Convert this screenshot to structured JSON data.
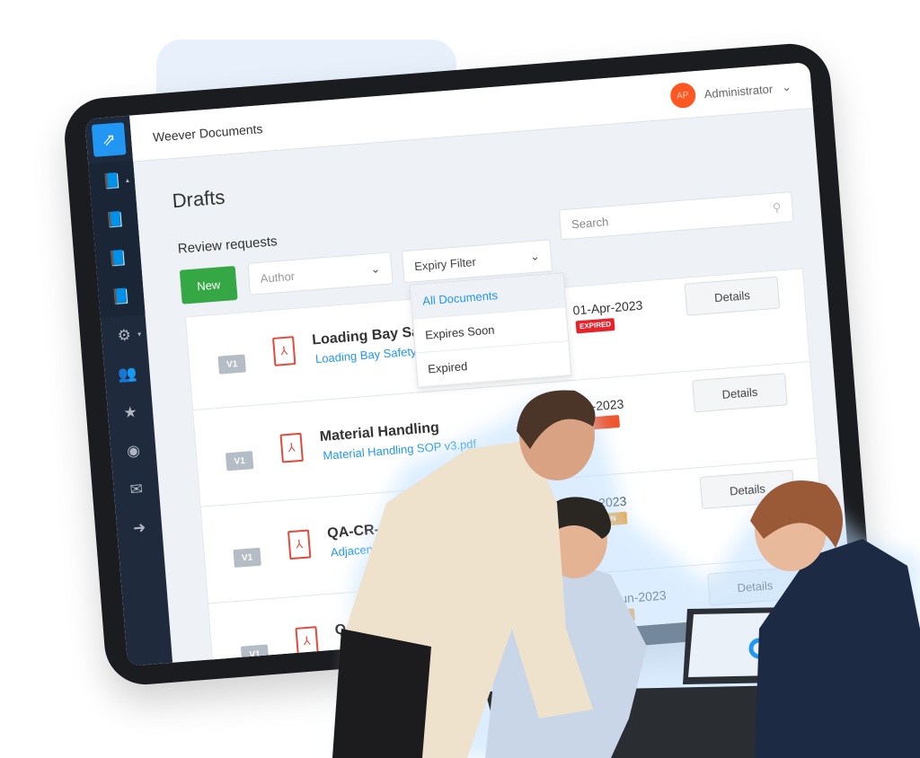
{
  "app": {
    "title": "Weever Documents",
    "logo_icon": "arrow-up-right-icon"
  },
  "user": {
    "initials": "AP",
    "name": "Administrator",
    "avatar_color": "#ff5722"
  },
  "sidebar": {
    "items": [
      {
        "icon": "book-icon",
        "caret": "▴"
      },
      {
        "icon": "book-icon"
      },
      {
        "icon": "book-icon"
      },
      {
        "icon": "book-icon"
      },
      {
        "icon": "gears-icon",
        "caret": "▾"
      },
      {
        "icon": "users-icon"
      },
      {
        "icon": "star-icon"
      },
      {
        "icon": "user-circle-icon"
      },
      {
        "icon": "envelope-icon"
      },
      {
        "icon": "sign-out-icon"
      }
    ]
  },
  "page": {
    "title": "Drafts",
    "section": "Review requests"
  },
  "toolbar": {
    "new_label": "New",
    "author_placeholder": "Author",
    "expiry_label": "Expiry Filter",
    "search_placeholder": "Search"
  },
  "expiry_menu": {
    "options": [
      "All Documents",
      "Expires Soon",
      "Expired"
    ],
    "selected": "All Documents"
  },
  "documents": [
    {
      "version": "V1",
      "title": "Loading Bay Saf",
      "file": "Loading Bay Safety S",
      "date": "01-Apr-2023",
      "badge": "EXPIRED",
      "badge_color": "#e8222b",
      "action": "Details"
    },
    {
      "version": "V1",
      "title": "Material Handling",
      "file": "Material Handling SOP v3.pdf",
      "date": "pr-2023",
      "badge": "",
      "badge_color": "#f0542b",
      "action": "Details"
    },
    {
      "version": "V1",
      "title": "QA-CR-",
      "file": "Adjacen",
      "date": "y-2023",
      "badge": "SOON",
      "badge_color": "#f59b1a",
      "action": "Details"
    },
    {
      "version": "V1",
      "title": "Q",
      "file": "",
      "date": "23-Jun-2023",
      "badge": "",
      "badge_color": "#f59b1a",
      "action": "Details"
    }
  ],
  "colors": {
    "accent": "#2196f3",
    "new_button": "#35a845",
    "sidebar": "#1f2b3d"
  }
}
